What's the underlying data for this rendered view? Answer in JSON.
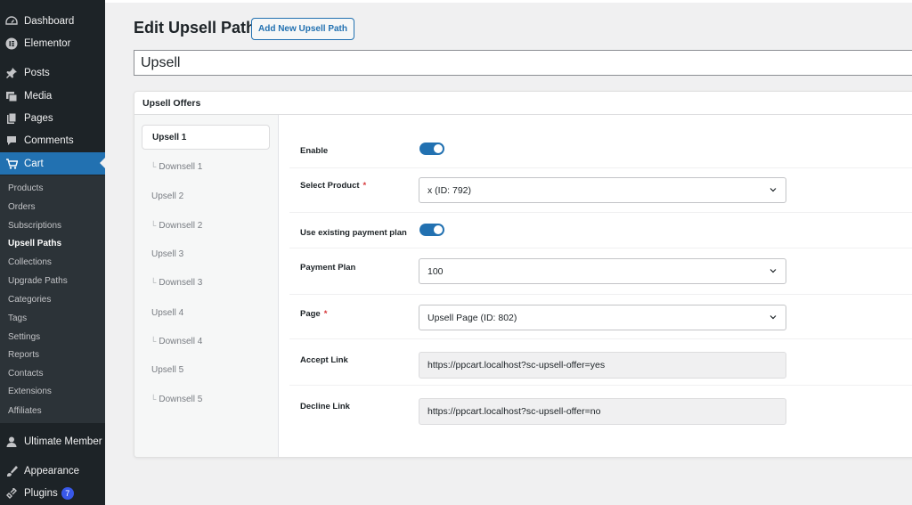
{
  "sidebar": {
    "dashboard": "Dashboard",
    "elementor": "Elementor",
    "posts": "Posts",
    "media": "Media",
    "pages": "Pages",
    "comments": "Comments",
    "cart": "Cart",
    "cart_submenu": [
      "Products",
      "Orders",
      "Subscriptions",
      "Upsell Paths",
      "Collections",
      "Upgrade Paths",
      "Categories",
      "Tags",
      "Settings",
      "Reports",
      "Contacts",
      "Extensions",
      "Affiliates"
    ],
    "ultimate_member": "Ultimate Member",
    "appearance": "Appearance",
    "plugins": "Plugins",
    "plugins_badge": "7"
  },
  "header": {
    "title": "Edit Upsell Path",
    "add_new_label": "Add New Upsell Path",
    "title_value": "Upsell"
  },
  "panel": {
    "title": "Upsell Offers",
    "offers": [
      "Upsell 1",
      "Downsell 1",
      "Upsell 2",
      "Downsell 2",
      "Upsell 3",
      "Downsell 3",
      "Upsell 4",
      "Downsell 4",
      "Upsell 5",
      "Downsell 5"
    ],
    "active_offer": "Upsell 1"
  },
  "form": {
    "enable_label": "Enable",
    "enable_on": true,
    "product_label": "Select Product",
    "product_value": "x (ID: 792)",
    "existing_plan_label": "Use existing payment plan",
    "existing_plan_on": true,
    "payment_plan_label": "Payment Plan",
    "payment_plan_value": "100",
    "page_label": "Page",
    "page_value": "Upsell Page (ID: 802)",
    "accept_label": "Accept Link",
    "accept_value": "https://ppcart.localhost?sc-upsell-offer=yes",
    "decline_label": "Decline Link",
    "decline_value": "https://ppcart.localhost?sc-upsell-offer=no",
    "required_mark": "*"
  },
  "colors": {
    "sidebar_bg": "#1d2327",
    "accent": "#2271b1",
    "required": "#d63638",
    "badge": "#3858e9"
  }
}
